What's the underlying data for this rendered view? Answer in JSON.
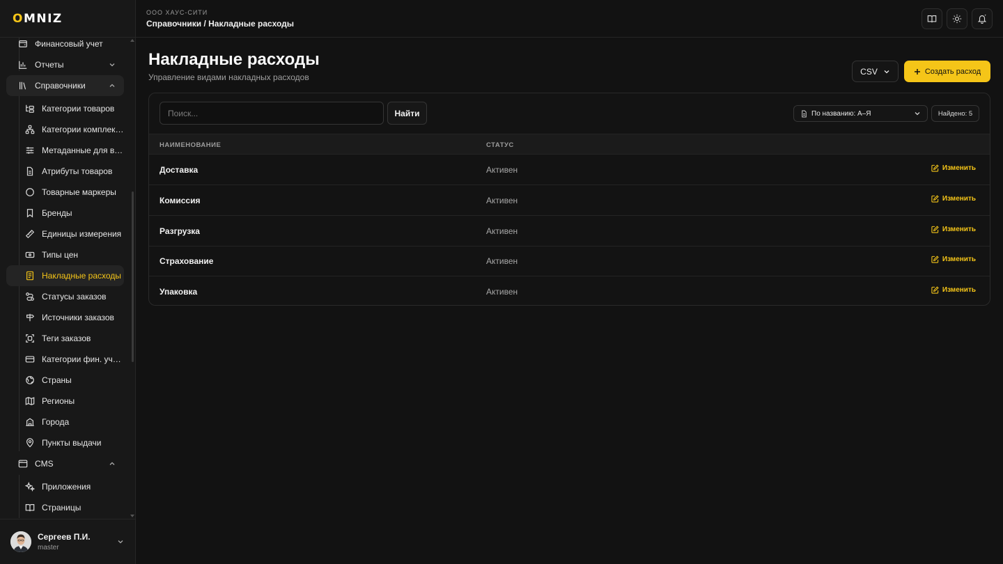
{
  "brand": {
    "logo_prefix": "O",
    "logo_rest": "MNIZ",
    "accent_color": "#f5c518"
  },
  "header": {
    "org": "ООО ХАУС-СИТИ",
    "breadcrumb": "Справочники / Накладные расходы",
    "icons": [
      "book-icon",
      "sun-icon",
      "bell-icon"
    ]
  },
  "sidebar": {
    "items": [
      {
        "label": "Финансовый учет",
        "icon": "wallet-icon"
      },
      {
        "label": "Отчеты",
        "icon": "bar-chart-icon"
      },
      {
        "label": "Справочники",
        "icon": "library-icon"
      },
      {
        "label": "Категории товаров",
        "icon": "folder-tree-icon"
      },
      {
        "label": "Категории комплектов",
        "icon": "network-icon"
      },
      {
        "label": "Метаданные для вариантов",
        "icon": "sliders-icon"
      },
      {
        "label": "Атрибуты товаров",
        "icon": "file-icon"
      },
      {
        "label": "Товарные маркеры",
        "icon": "circle-icon"
      },
      {
        "label": "Бренды",
        "icon": "bookmark-icon"
      },
      {
        "label": "Единицы измерения",
        "icon": "ruler-icon"
      },
      {
        "label": "Типы цен",
        "icon": "banknote-icon"
      },
      {
        "label": "Накладные расходы",
        "icon": "receipt-icon"
      },
      {
        "label": "Статусы заказов",
        "icon": "route-icon"
      },
      {
        "label": "Источники заказов",
        "icon": "signpost-icon"
      },
      {
        "label": "Теги заказов",
        "icon": "tag-scan-icon"
      },
      {
        "label": "Категории фин. учета",
        "icon": "card-icon"
      },
      {
        "label": "Страны",
        "icon": "globe-icon"
      },
      {
        "label": "Регионы",
        "icon": "map-icon"
      },
      {
        "label": "Города",
        "icon": "building-icon"
      },
      {
        "label": "Пункты выдачи",
        "icon": "pin-icon"
      },
      {
        "label": "CMS",
        "icon": "browser-icon"
      },
      {
        "label": "Приложения",
        "icon": "sparkles-icon"
      },
      {
        "label": "Страницы",
        "icon": "book-open-icon"
      }
    ]
  },
  "user": {
    "name": "Сергеев П.И.",
    "role": "master"
  },
  "page": {
    "title": "Накладные расходы",
    "subtitle": "Управление видами накладных расходов",
    "csv_label": "CSV",
    "create_label": "Создать расход"
  },
  "toolbar": {
    "search_placeholder": "Поиск...",
    "search_value": "",
    "find_label": "Найти",
    "sort_label": "По названию: А–Я",
    "found_label": "Найдено: 5"
  },
  "table": {
    "columns": [
      "НАИМЕНОВАНИЕ",
      "СТАТУС"
    ],
    "edit_label": "Изменить",
    "rows": [
      {
        "name": "Доставка",
        "status": "Активен"
      },
      {
        "name": "Комиссия",
        "status": "Активен"
      },
      {
        "name": "Разгрузка",
        "status": "Активен"
      },
      {
        "name": "Страхование",
        "status": "Активен"
      },
      {
        "name": "Упаковка",
        "status": "Активен"
      }
    ]
  }
}
